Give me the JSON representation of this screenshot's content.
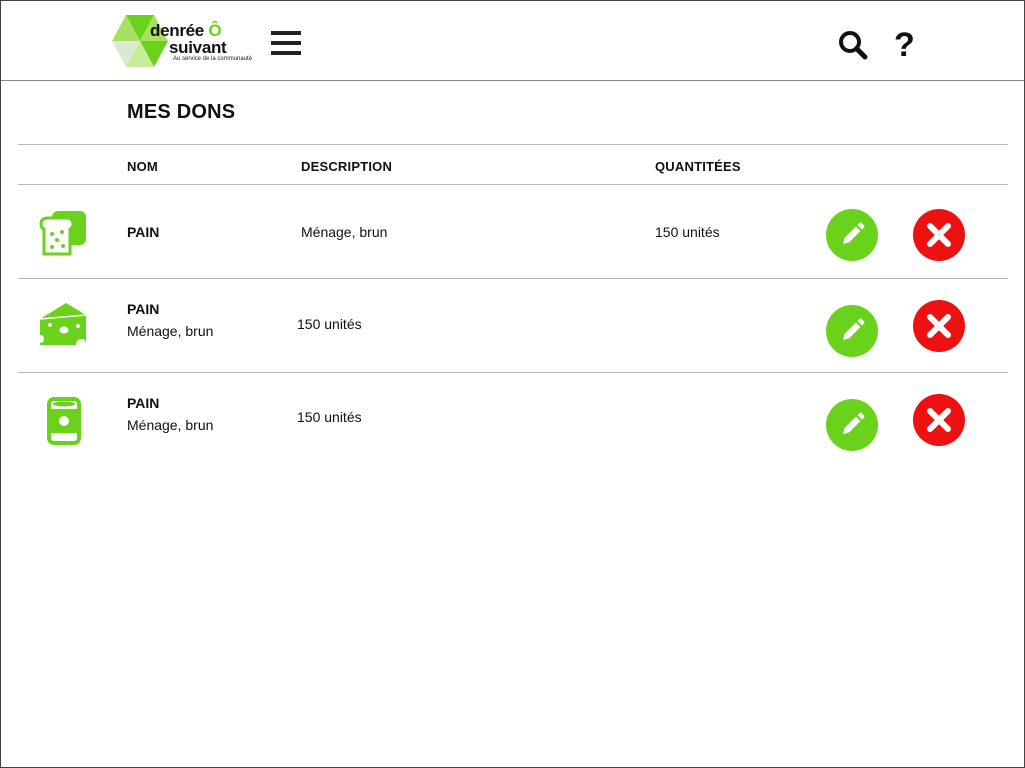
{
  "header": {
    "logo": {
      "line1_pre": "denrée",
      "line1_o": "Ô",
      "line2": "suivant",
      "tagline": "Au service de la communauté"
    },
    "icons": [
      "menu-icon",
      "search-icon",
      "help-icon"
    ],
    "help_label": "?"
  },
  "page": {
    "title": "MES DONS"
  },
  "table": {
    "columns": [
      "NOM",
      "DESCRIPTION",
      "QUANTITÉES"
    ],
    "rows": [
      {
        "icon": "bread-icon",
        "name": "PAIN",
        "description": "Ménage, brun",
        "quantity": "150 unités"
      },
      {
        "icon": "cheese-icon",
        "name": "PAIN",
        "description": "Ménage, brun",
        "quantity": "150 unités"
      },
      {
        "icon": "can-icon",
        "name": "PAIN",
        "description": "Ménage, brun",
        "quantity": "150 unités"
      }
    ]
  },
  "colors": {
    "accent_green": "#6bd21c",
    "delete_red": "#ee1111",
    "text": "#111111"
  }
}
